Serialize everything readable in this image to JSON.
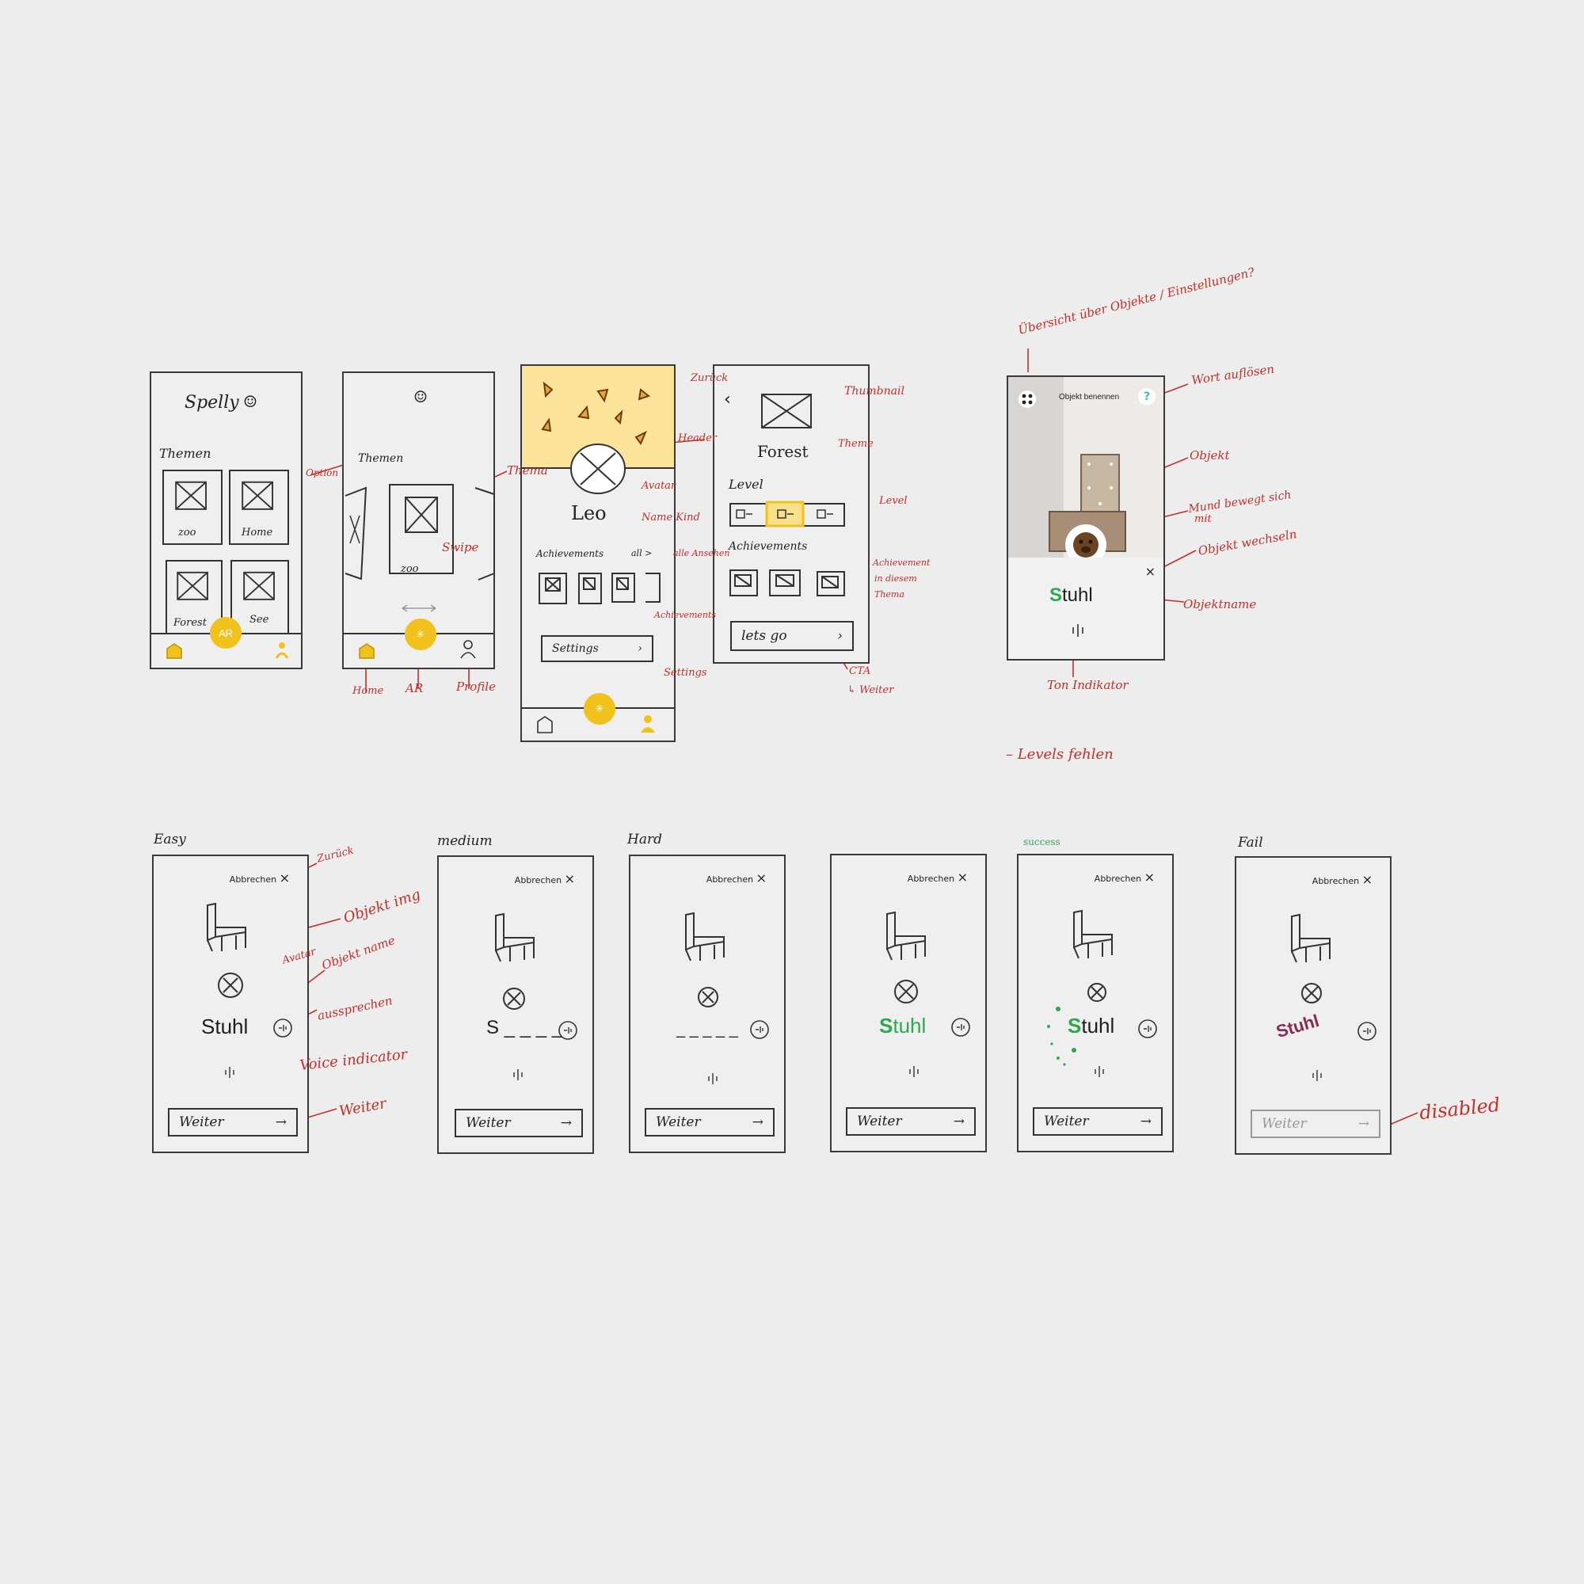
{
  "screens": {
    "home": {
      "title": "Spelly",
      "smile": "☺",
      "section": "Themen",
      "tiles": [
        "zoo",
        "Home",
        "Forest",
        "See"
      ],
      "ar": "AR"
    },
    "carousel": {
      "section": "Themen",
      "tile": "zoo"
    },
    "profile": {
      "name": "Leo",
      "achievements": "Achievements",
      "all": "all >",
      "settings": "Settings"
    },
    "detail": {
      "theme": "Forest",
      "level": "Level",
      "achievements": "Achievements",
      "cta": "lets go"
    },
    "ar_view": {
      "header": "Objekt benennen",
      "help": "?",
      "word": "Stuhl"
    },
    "levels": [
      {
        "title": "Easy",
        "abort": "Abbrechen",
        "word": "Stuhl",
        "button": "Weiter"
      },
      {
        "title": "medium",
        "abort": "Abbrechen",
        "word": "S _ _ _ _",
        "button": "Weiter"
      },
      {
        "title": "Hard",
        "abort": "Abbrechen",
        "word": "_ _ _ _ _",
        "button": "Weiter"
      },
      {
        "title": "",
        "abort": "Abbrechen",
        "word": "Stuhl",
        "button": "Weiter"
      },
      {
        "title": "success",
        "abort": "Abbrechen",
        "word": "Stuhl",
        "button": "Weiter"
      },
      {
        "title": "Fail",
        "abort": "Abbrechen",
        "word": "Stuhl",
        "button": "Weiter"
      }
    ]
  },
  "annotations": {
    "option": "Option",
    "thema": "Thema",
    "swipe": "Swipe",
    "home": "Home",
    "ar": "AR",
    "profile": "Profile",
    "header": "Header",
    "avatar": "Avatar",
    "name_kind": "Name Kind",
    "alle_ansehen": "alle Ansehen",
    "achievements": "Achievements",
    "settings": "Settings",
    "zurueck": "Zurück",
    "thumbnail": "Thumbnail",
    "theme": "Theme",
    "level": "Level",
    "achievement_theme_1": "Achievement",
    "achievement_theme_2": "in diesem",
    "achievement_theme_3": "Thema",
    "cta": "CTA",
    "cta_weiter": "↳ Weiter",
    "uebersicht": "Übersicht über Objekte / Einstellungen?",
    "wort_aufloesen": "Wort auflösen",
    "objekt": "Objekt",
    "mund_1": "Mund bewegt sich",
    "mund_2": "mit",
    "objekt_wechseln": "Objekt wechseln",
    "objektname": "Objektname",
    "ton_indikator": "Ton Indikator",
    "levels_fehlen": "– Levels fehlen",
    "easy_zurueck": "Zurück",
    "objekt_img": "Objekt img",
    "avatar2": "Avatar",
    "objekt_name": "Objekt name",
    "aussprechen": "aussprechen",
    "voice_indicator": "Voice indicator",
    "weiter": "Weiter",
    "disabled": "disabled"
  },
  "colors": {
    "accent": "#f1c21b",
    "annotation": "#c3302a",
    "success": "#2ea84f",
    "fail": "#8a2a4f",
    "help": "#3fb6c9"
  }
}
